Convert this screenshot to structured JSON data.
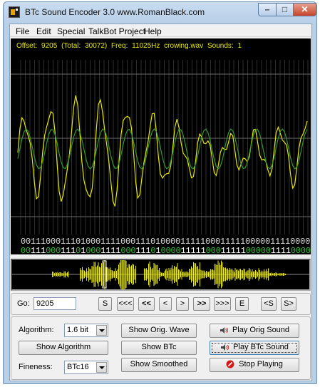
{
  "window": {
    "title": "BTc Sound Encoder 3.0    www.RomanBlack.com"
  },
  "caption": {
    "minimize": "–",
    "maximize": "□",
    "close": "✕"
  },
  "menu": [
    {
      "label": "File"
    },
    {
      "label": "Edit"
    },
    {
      "label": "Special"
    },
    {
      "label": "TalkBot Project"
    },
    {
      "label": "Help"
    }
  ],
  "scope": {
    "info": "Offset: 9205   (Total: 30072)   Freq: 11025Hz   crowing.wav   Sounds: 1",
    "colors": {
      "wave": "#e8e800",
      "smoothed": "#2f9a2f",
      "grid": "#6a6a6a",
      "bit_one": "#ffffff",
      "bit_zero": "#36c236"
    },
    "bits_top": "00111000111010001111000111010000111110001111100000111100001110",
    "bits_bottom": "00111000111010001111000111010000111110001111100000111100001110"
  },
  "overview": {
    "colors": {
      "wave": "#f0ee00",
      "baseline": "#8a8a8a"
    }
  },
  "nav": {
    "go_label": "Go:",
    "offset_value": "9205",
    "s_label": "S",
    "first": "<<<",
    "prev_big": "<<",
    "prev": "<",
    "next": ">",
    "next_big": ">>",
    "last": ">>>",
    "e_label": "E",
    "prev_sound": "<S",
    "next_sound": "S>"
  },
  "controls": {
    "algorithm_label": "Algorithm:",
    "algorithm_value": "1.6 bit",
    "show_algorithm": "Show Algorithm",
    "fineness_label": "Fineness:",
    "fineness_value": "BTc16",
    "show_orig_wave": "Show Orig. Wave",
    "show_btc": "Show BTc",
    "show_smoothed": "Show Smoothed",
    "play_orig_sound": "Play Orig Sound",
    "play_btc_sound": "Play BTc Sound",
    "stop_playing": "Stop Playing"
  }
}
